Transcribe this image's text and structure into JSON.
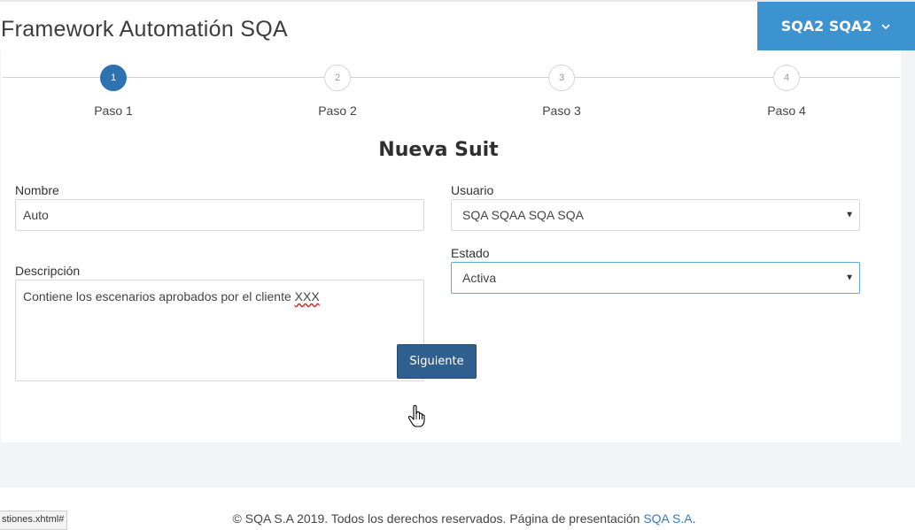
{
  "header": {
    "app_title": "Framework Automatión SQA",
    "user_name": "SQA2 SQA2"
  },
  "wizard": {
    "steps": [
      {
        "number": "1",
        "label": "Paso 1",
        "active": true
      },
      {
        "number": "2",
        "label": "Paso 2",
        "active": false
      },
      {
        "number": "3",
        "label": "Paso 3",
        "active": false
      },
      {
        "number": "4",
        "label": "Paso 4",
        "active": false
      }
    ]
  },
  "form": {
    "title": "Nueva Suit",
    "nombre": {
      "label": "Nombre",
      "value": "Auto"
    },
    "descripcion": {
      "label": "Descripción",
      "value_prefix": "Contiene los escenarios aprobados por el cliente ",
      "value_suffix": "XXX"
    },
    "usuario": {
      "label": "Usuario",
      "selected": "SQA SQAA SQA SQA"
    },
    "estado": {
      "label": "Estado",
      "selected": "Activa"
    },
    "next_button": "Siguiente"
  },
  "footer": {
    "text": "© SQA S.A 2019. Todos los derechos reservados. Página de presentación ",
    "link": "SQA S.A",
    "suffix": "."
  },
  "status_bar": {
    "url": "stiones.xhtml#"
  },
  "colors": {
    "accent": "#3d92d0",
    "active_step": "#2f72b2",
    "button": "#2e5f8e",
    "page_band": "#f1f5f8",
    "link": "#3a7ab8"
  },
  "icons": [
    "chevron-down-icon",
    "select-arrow-icon",
    "resize-grip-icon",
    "hand-pointer-icon"
  ]
}
